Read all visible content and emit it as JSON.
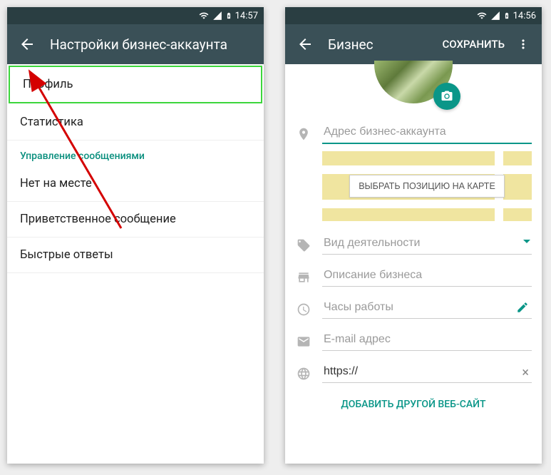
{
  "left": {
    "status_time": "14:57",
    "appbar_title": "Настройки бизнес-аккаунта",
    "items": {
      "profile": "Профиль",
      "stats": "Статистика",
      "section_messages": "Управление сообщениями",
      "away": "Нет на месте",
      "greeting": "Приветственное сообщение",
      "quick": "Быстрые ответы"
    }
  },
  "right": {
    "status_time": "14:56",
    "appbar_title": "Бизнес",
    "save_action": "СОХРАНИТЬ",
    "fields": {
      "address_placeholder": "Адрес бизнес-аккаунта",
      "map_button": "ВЫБРАТЬ ПОЗИЦИЮ НА КАРТЕ",
      "category_placeholder": "Вид деятельности",
      "description_placeholder": "Описание бизнеса",
      "hours_placeholder": "Часы работы",
      "email_placeholder": "E-mail адрес",
      "website_value": "https://",
      "add_website": "ДОБАВИТЬ ДРУГОЙ ВЕБ-САЙТ"
    }
  }
}
